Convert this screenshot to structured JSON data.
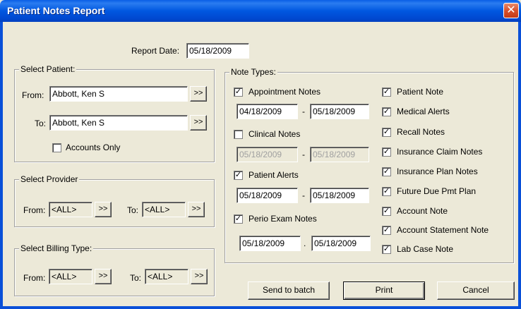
{
  "window": {
    "title": "Patient Notes Report",
    "close_glyph": "✕"
  },
  "report_date": {
    "label": "Report Date:",
    "value": "05/18/2009"
  },
  "select_patient": {
    "title": "Select Patient:",
    "from_label": "From:",
    "from_value": "Abbott, Ken S",
    "to_label": "To:",
    "to_value": "Abbott, Ken S",
    "browse_label": ">>",
    "accounts_only_label": "Accounts Only",
    "accounts_only_checked": false
  },
  "select_provider": {
    "title": "Select Provider",
    "from_label": "From:",
    "from_value": "<ALL>",
    "to_label": "To:",
    "to_value": "<ALL>",
    "browse_label": ">>"
  },
  "select_billing_type": {
    "title": "Select Billing Type:",
    "from_label": "From:",
    "from_value": "<ALL>",
    "to_label": "To:",
    "to_value": "<ALL>",
    "browse_label": ">>"
  },
  "note_types": {
    "title": "Note Types:",
    "left": [
      {
        "label": "Appointment Notes",
        "checked": true,
        "from": "04/18/2009",
        "to": "05/18/2009",
        "sep": "-",
        "enabled": true
      },
      {
        "label": "Clinical Notes",
        "checked": false,
        "from": "05/18/2009",
        "to": "05/18/2009",
        "sep": "-",
        "enabled": false
      },
      {
        "label": "Patient Alerts",
        "checked": true,
        "from": "05/18/2009",
        "to": "05/18/2009",
        "sep": "-",
        "enabled": true
      },
      {
        "label": "Perio Exam Notes",
        "checked": true,
        "from": "05/18/2009",
        "to": "05/18/2009",
        "sep": ".",
        "enabled": true
      }
    ],
    "right": [
      {
        "label": "Patient Note",
        "checked": true
      },
      {
        "label": "Medical Alerts",
        "checked": true
      },
      {
        "label": "Recall Notes",
        "checked": true
      },
      {
        "label": "Insurance Claim Notes",
        "checked": true
      },
      {
        "label": "Insurance Plan Notes",
        "checked": true
      },
      {
        "label": "Future Due Pmt Plan",
        "checked": true
      },
      {
        "label": "Account Note",
        "checked": true
      },
      {
        "label": "Account Statement Note",
        "checked": true
      },
      {
        "label": "Lab Case Note",
        "checked": true
      }
    ]
  },
  "buttons": {
    "send_to_batch": "Send to batch",
    "print": "Print",
    "cancel": "Cancel"
  },
  "check_glyph": "✓"
}
